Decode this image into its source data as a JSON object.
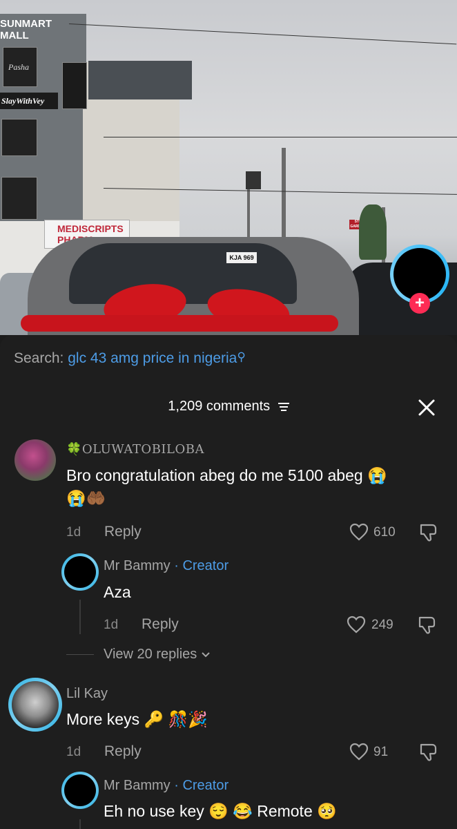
{
  "video": {
    "mall_sign": "SUNMART MALL",
    "brand_sign": "SlayWithVey",
    "poster_label": "Pasha",
    "pharmacy_sign": "MEDISCRIPTS PHARM",
    "plate": "KJA 969",
    "street_sign": "STILL WATER GARDENS ESTATE"
  },
  "search": {
    "prefix": "Search:",
    "query": "glc 43 amg price in nigeria"
  },
  "header": {
    "count": "1,209 comments"
  },
  "comments": [
    {
      "username": "🍀OLUWATOBILOBA",
      "text_line1": "Bro congratulation abeg do me 5100 abeg 😭",
      "text_line2": "😭🤲🏾",
      "time": "1d",
      "reply_label": "Reply",
      "likes": "610",
      "replies": [
        {
          "username": "Mr Bammy",
          "badge": "· Creator",
          "text": "Aza",
          "time": "1d",
          "reply_label": "Reply",
          "likes": "249"
        }
      ],
      "view_replies": "View 20 replies"
    },
    {
      "username": "Lil Kay",
      "text_line1": "More keys 🔑 🎊🎉",
      "time": "1d",
      "reply_label": "Reply",
      "likes": "91",
      "replies": [
        {
          "username": "Mr Bammy",
          "badge": "· Creator",
          "text": "Eh no use key 😌 😂 Remote 🥺"
        }
      ]
    }
  ],
  "colors": {
    "accent": "#4d9ce6",
    "plus": "#fe2c55",
    "sheet": "#1e1e1e",
    "muted": "#a6a6a6"
  }
}
